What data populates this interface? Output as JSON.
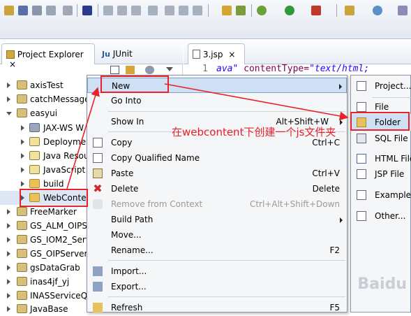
{
  "left_tabs": [
    {
      "label": "Project Explorer"
    },
    {
      "label": "JUnit"
    }
  ],
  "editor": {
    "tab_label": "3.jsp",
    "line_number": "1",
    "code_attr": "ava\"",
    "code_keyword": "contentType=",
    "code_value": "\"text/html;"
  },
  "tree": [
    {
      "label": "axisTest"
    },
    {
      "label": "catchMessage"
    },
    {
      "label": "easyui"
    },
    {
      "label": "JAX-WS W"
    },
    {
      "label": "Deploymen"
    },
    {
      "label": "Java Resou"
    },
    {
      "label": "JavaScript"
    },
    {
      "label": "build"
    },
    {
      "label": "WebConte"
    },
    {
      "label": "FreeMarker"
    },
    {
      "label": "GS_ALM_OIPS"
    },
    {
      "label": "GS_IOM2_Serv"
    },
    {
      "label": "GS_OIPServer"
    },
    {
      "label": "gsDataGrab"
    },
    {
      "label": "inas4jf_yj"
    },
    {
      "label": "INASServiceQ"
    },
    {
      "label": "JavaBase"
    }
  ],
  "context_menu": {
    "new": "New",
    "go_into": "Go Into",
    "show_in": "Show In",
    "show_in_shortcut": "Alt+Shift+W",
    "copy": "Copy",
    "copy_shortcut": "Ctrl+C",
    "copy_qualified": "Copy Qualified Name",
    "paste": "Paste",
    "paste_shortcut": "Ctrl+V",
    "delete": "Delete",
    "delete_shortcut": "Delete",
    "remove_context": "Remove from Context",
    "remove_context_shortcut": "Ctrl+Alt+Shift+Down",
    "build_path": "Build Path",
    "move": "Move...",
    "rename": "Rename...",
    "rename_shortcut": "F2",
    "import": "Import...",
    "export": "Export...",
    "refresh": "Refresh",
    "refresh_shortcut": "F5"
  },
  "submenu": {
    "project": "Project...",
    "file": "File",
    "folder": "Folder",
    "sql_file": "SQL File",
    "html_file": "HTML File",
    "jsp_file": "JSP File",
    "example": "Example...",
    "other": "Other..."
  },
  "annotation": "在webcontent下创建一个js文件夹",
  "watermark": "Baidu",
  "colors": {
    "highlight": "#e8222b",
    "folder": "#e8c15a",
    "code_keyword": "#7f0055",
    "code_string": "#2a00ff"
  }
}
